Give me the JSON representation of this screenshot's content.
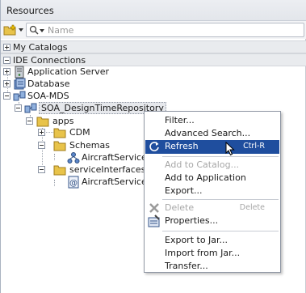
{
  "panel": {
    "title": "Resources"
  },
  "toolbar": {
    "search_placeholder": "Name"
  },
  "sections": {
    "my_catalogs": "My Catalogs",
    "ide_connections": "IDE Connections"
  },
  "tree": {
    "application_server": "Application Server",
    "database": "Database",
    "soa_mds": "SOA-MDS",
    "repository": "SOA_DesignTimeRepository",
    "apps": "apps",
    "cdm": "CDM",
    "schemas": "Schemas",
    "aircraft_service_xsd": "AircraftService.x",
    "service_interfaces": "serviceInterfaces",
    "aircraft_service_wsdl": "AircraftService.v"
  },
  "context_menu": {
    "filter": "Filter...",
    "advanced_search": "Advanced Search...",
    "refresh": "Refresh",
    "refresh_shortcut": "Ctrl-R",
    "add_to_catalog": "Add to Catalog...",
    "add_to_application": "Add to Application",
    "export": "Export...",
    "delete": "Delete",
    "delete_shortcut": "Delete",
    "properties": "Properties...",
    "export_to_jar": "Export to Jar...",
    "import_from_jar": "Import from Jar...",
    "transfer": "Transfer..."
  },
  "colors": {
    "highlight": "#1f4e9e",
    "folder": "#e8c34a",
    "section_bg": "#e9ebee"
  }
}
